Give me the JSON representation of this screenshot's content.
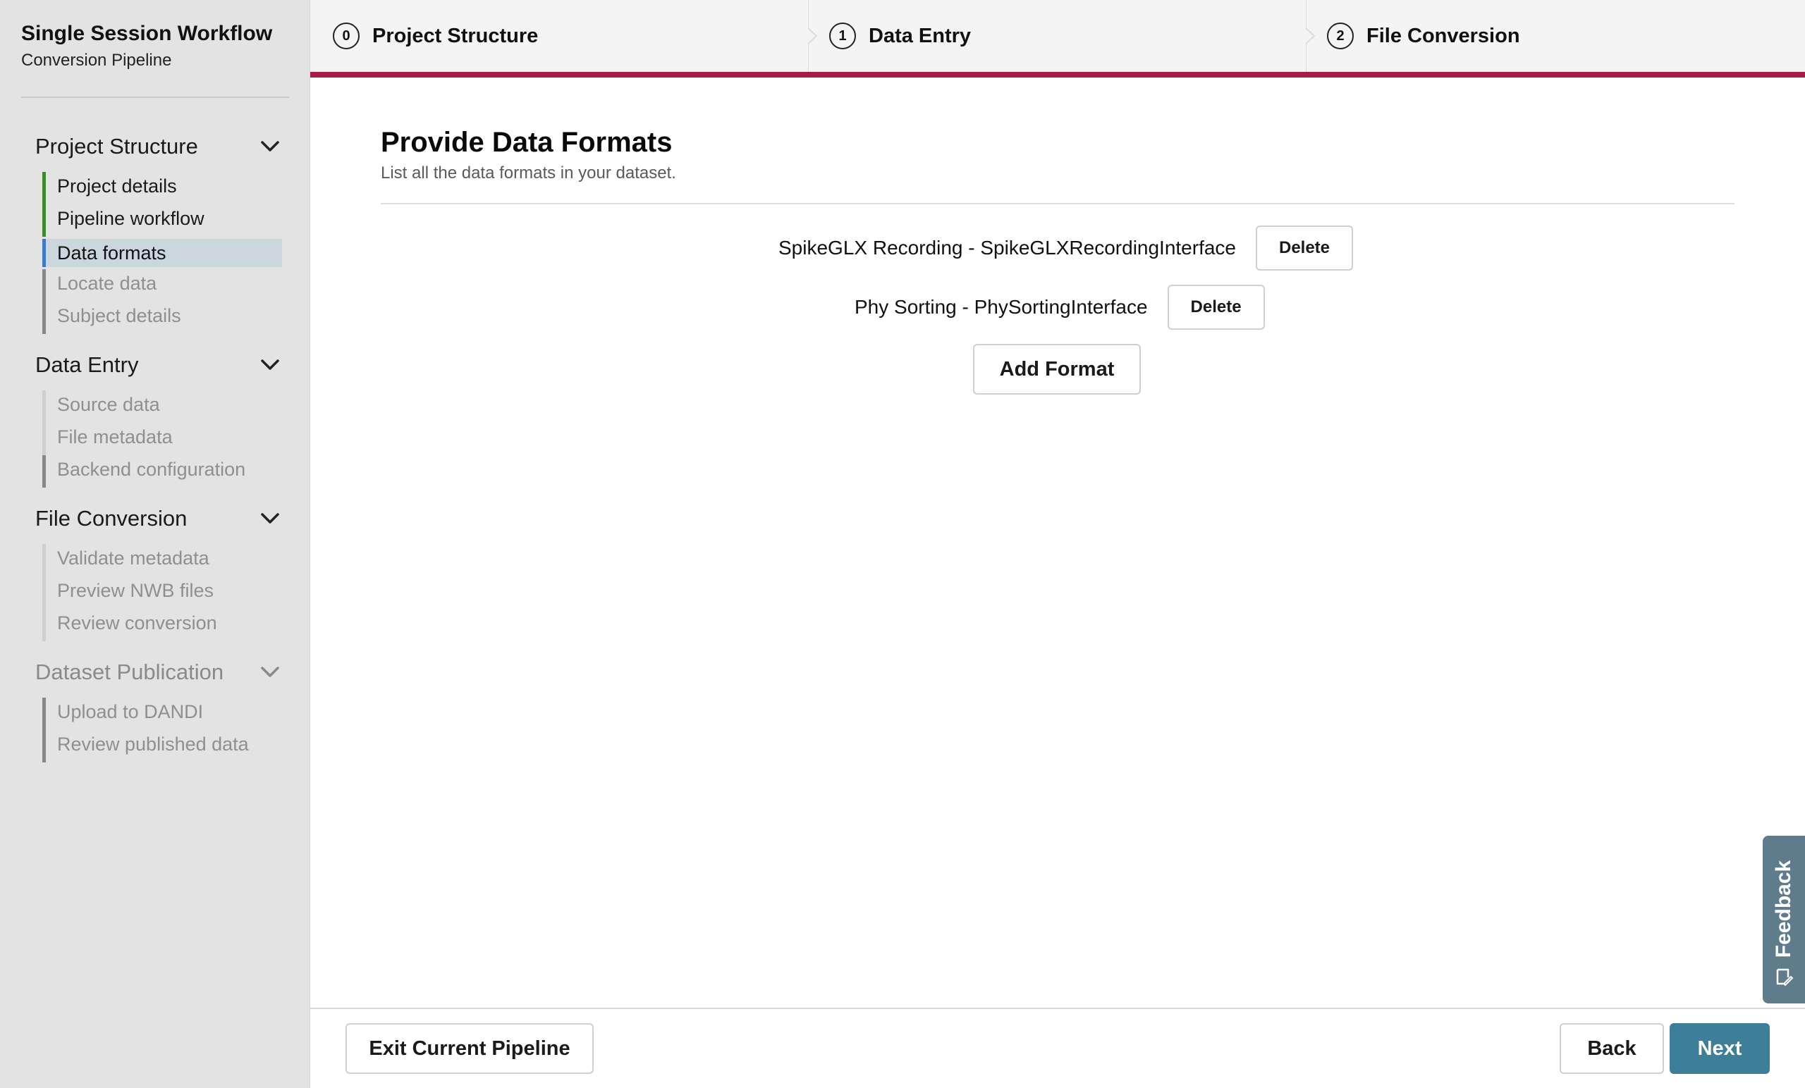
{
  "sidebar": {
    "title": "Single Session Workflow",
    "subtitle": "Conversion Pipeline",
    "sections": [
      {
        "label": "Project Structure",
        "items": [
          {
            "label": "Project details"
          },
          {
            "label": "Pipeline workflow"
          },
          {
            "label": "Data formats"
          },
          {
            "label": "Locate data"
          },
          {
            "label": "Subject details"
          }
        ]
      },
      {
        "label": "Data Entry",
        "items": [
          {
            "label": "Source data"
          },
          {
            "label": "File metadata"
          },
          {
            "label": "Backend configuration"
          }
        ]
      },
      {
        "label": "File Conversion",
        "items": [
          {
            "label": "Validate metadata"
          },
          {
            "label": "Preview NWB files"
          },
          {
            "label": "Review conversion"
          }
        ]
      },
      {
        "label": "Dataset Publication",
        "items": [
          {
            "label": "Upload to DANDI"
          },
          {
            "label": "Review published data"
          }
        ]
      }
    ]
  },
  "stepper": {
    "steps": [
      {
        "num": "0",
        "label": "Project Structure"
      },
      {
        "num": "1",
        "label": "Data Entry"
      },
      {
        "num": "2",
        "label": "File Conversion"
      }
    ],
    "accent_color": "#a81d45"
  },
  "main": {
    "title": "Provide Data Formats",
    "subtitle": "List all the data formats in your dataset.",
    "formats": [
      {
        "label": "SpikeGLX Recording - SpikeGLXRecordingInterface",
        "delete_label": "Delete"
      },
      {
        "label": "Phy Sorting - PhySortingInterface",
        "delete_label": "Delete"
      }
    ],
    "add_format_label": "Add Format"
  },
  "footer": {
    "exit_label": "Exit Current Pipeline",
    "back_label": "Back",
    "next_label": "Next",
    "next_color": "#3d7f99"
  },
  "feedback": {
    "label": "Feedback",
    "icon": "feedback-icon"
  }
}
